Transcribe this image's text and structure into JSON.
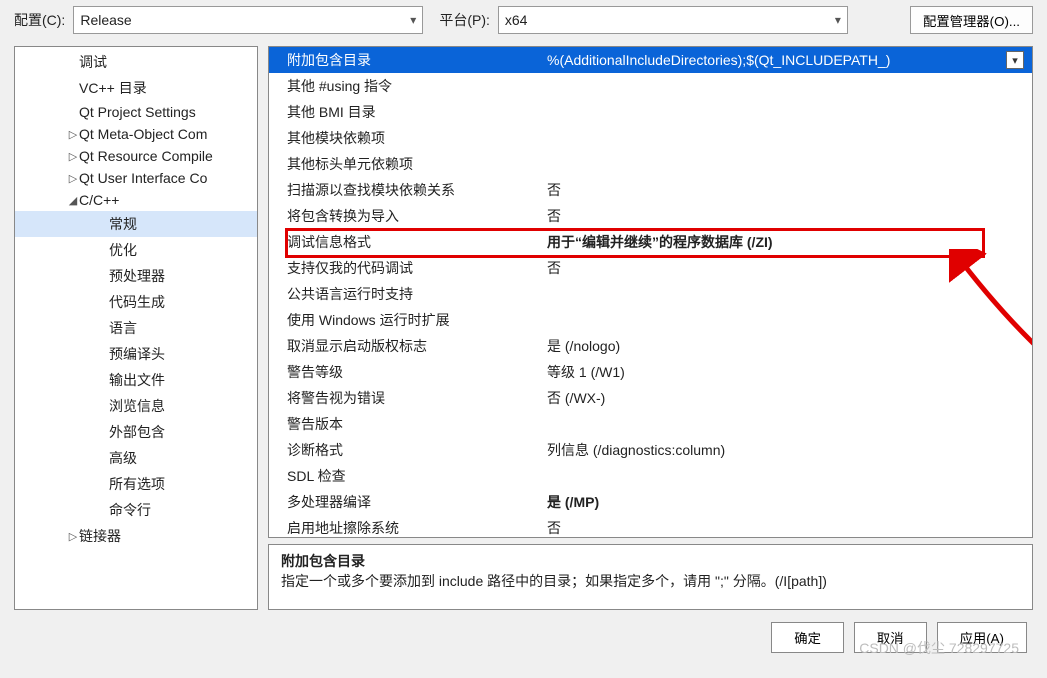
{
  "top": {
    "config_label": "配置(C):",
    "config_value": "Release",
    "platform_label": "平台(P):",
    "platform_value": "x64",
    "config_mgr_btn": "配置管理器(O)..."
  },
  "tree": {
    "items": [
      {
        "label": "调试",
        "indent": "i1",
        "tw": ""
      },
      {
        "label": "VC++ 目录",
        "indent": "i1",
        "tw": ""
      },
      {
        "label": "Qt Project Settings",
        "indent": "i1",
        "tw": ""
      },
      {
        "label": "Qt Meta-Object Com",
        "indent": "i2",
        "tw": "▷"
      },
      {
        "label": "Qt Resource Compile",
        "indent": "i2",
        "tw": "▷"
      },
      {
        "label": "Qt User Interface Co",
        "indent": "i2",
        "tw": "▷"
      },
      {
        "label": "C/C++",
        "indent": "i2",
        "tw": "◢",
        "expanded": true
      },
      {
        "label": "常规",
        "indent": "i3",
        "tw": "",
        "selected": true
      },
      {
        "label": "优化",
        "indent": "i3",
        "tw": ""
      },
      {
        "label": "预处理器",
        "indent": "i3",
        "tw": ""
      },
      {
        "label": "代码生成",
        "indent": "i3",
        "tw": ""
      },
      {
        "label": "语言",
        "indent": "i3",
        "tw": ""
      },
      {
        "label": "预编译头",
        "indent": "i3",
        "tw": ""
      },
      {
        "label": "输出文件",
        "indent": "i3",
        "tw": ""
      },
      {
        "label": "浏览信息",
        "indent": "i3",
        "tw": ""
      },
      {
        "label": "外部包含",
        "indent": "i3",
        "tw": ""
      },
      {
        "label": "高级",
        "indent": "i3",
        "tw": ""
      },
      {
        "label": "所有选项",
        "indent": "i3",
        "tw": ""
      },
      {
        "label": "命令行",
        "indent": "i3",
        "tw": ""
      },
      {
        "label": "链接器",
        "indent": "i2",
        "tw": "▷"
      }
    ]
  },
  "grid": {
    "rows": [
      {
        "name": "附加包含目录",
        "value": "%(AdditionalIncludeDirectories);$(Qt_INCLUDEPATH_)",
        "selected": true
      },
      {
        "name": "其他 #using 指令",
        "value": ""
      },
      {
        "name": "其他 BMI 目录",
        "value": ""
      },
      {
        "name": "其他模块依赖项",
        "value": ""
      },
      {
        "name": "其他标头单元依赖项",
        "value": ""
      },
      {
        "name": "扫描源以查找模块依赖关系",
        "value": "否"
      },
      {
        "name": "将包含转换为导入",
        "value": "否"
      },
      {
        "name": "调试信息格式",
        "value": "用于“编辑并继续”的程序数据库 (/ZI)",
        "bold": true,
        "highlight": true
      },
      {
        "name": "支持仅我的代码调试",
        "value": "否"
      },
      {
        "name": "公共语言运行时支持",
        "value": ""
      },
      {
        "name": "使用 Windows 运行时扩展",
        "value": ""
      },
      {
        "name": "取消显示启动版权标志",
        "value": "是 (/nologo)"
      },
      {
        "name": "警告等级",
        "value": "等级 1 (/W1)"
      },
      {
        "name": "将警告视为错误",
        "value": "否 (/WX-)"
      },
      {
        "name": "警告版本",
        "value": ""
      },
      {
        "name": "诊断格式",
        "value": "列信息 (/diagnostics:column)"
      },
      {
        "name": "SDL 检查",
        "value": ""
      },
      {
        "name": "多处理器编译",
        "value": "是 (/MP)",
        "bold": true
      },
      {
        "name": "启用地址擦除系统",
        "value": "否"
      }
    ]
  },
  "desc": {
    "title": "附加包含目录",
    "body": "指定一个或多个要添加到 include 路径中的目录；如果指定多个，请用 \";\" 分隔。(/I[path])"
  },
  "footer": {
    "ok": "确定",
    "cancel": "取消",
    "apply": "应用(A)"
  },
  "watermark": "CSDN @伐尘 728297725"
}
